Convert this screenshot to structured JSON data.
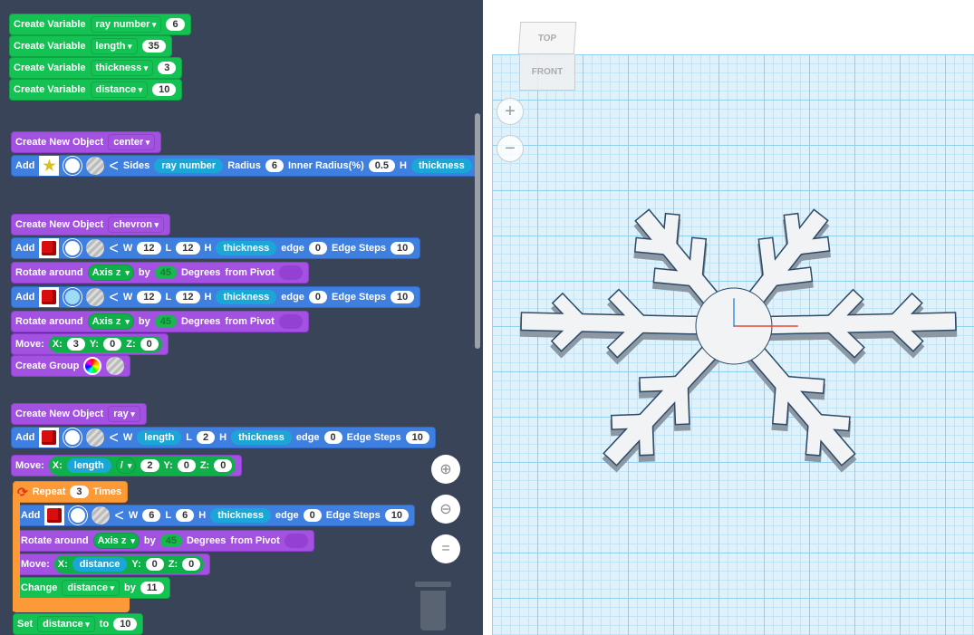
{
  "workspace": {
    "blocks": [
      {
        "color": "green",
        "parts": [
          [
            "l",
            "Create Variable"
          ],
          [
            "d",
            "ray number"
          ],
          [
            "p",
            "6"
          ]
        ]
      },
      {
        "color": "green",
        "parts": [
          [
            "l",
            "Create Variable"
          ],
          [
            "d",
            "length"
          ],
          [
            "p",
            "35"
          ]
        ]
      },
      {
        "color": "green",
        "parts": [
          [
            "l",
            "Create Variable"
          ],
          [
            "d",
            "thickness"
          ],
          [
            "p",
            "3"
          ]
        ]
      },
      {
        "color": "green",
        "parts": [
          [
            "l",
            "Create Variable"
          ],
          [
            "d",
            "distance"
          ],
          [
            "p",
            "10"
          ]
        ]
      },
      {
        "color": "purple",
        "parts": [
          [
            "l",
            "Create New Object"
          ],
          [
            "d",
            "center"
          ]
        ]
      },
      {
        "color": "blue",
        "parts": [
          [
            "l",
            "Add"
          ],
          [
            "i",
            "star"
          ],
          [
            "i",
            "circle"
          ],
          [
            "i",
            "striped"
          ],
          [
            "c",
            "<"
          ],
          [
            "l",
            "Sides"
          ],
          [
            "v",
            "ray number"
          ],
          [
            "l",
            "Radius"
          ],
          [
            "p",
            "6"
          ],
          [
            "l",
            "Inner Radius(%)"
          ],
          [
            "p",
            "0.5"
          ],
          [
            "l",
            "H"
          ],
          [
            "v",
            "thickness"
          ]
        ]
      },
      {
        "color": "purple",
        "parts": [
          [
            "l",
            "Create New Object"
          ],
          [
            "d",
            "chevron"
          ]
        ]
      },
      {
        "color": "blue",
        "parts": [
          [
            "l",
            "Add"
          ],
          [
            "i",
            "cube"
          ],
          [
            "i",
            "circle"
          ],
          [
            "i",
            "striped"
          ],
          [
            "c",
            "<"
          ],
          [
            "l",
            "W"
          ],
          [
            "p",
            "12"
          ],
          [
            "l",
            "L"
          ],
          [
            "p",
            "12"
          ],
          [
            "l",
            "H"
          ],
          [
            "v",
            "thickness"
          ],
          [
            "l",
            "edge"
          ],
          [
            "p",
            "0"
          ],
          [
            "l",
            "Edge Steps"
          ],
          [
            "p",
            "10"
          ]
        ]
      },
      {
        "color": "purple",
        "parts": [
          [
            "l",
            "Rotate around"
          ],
          [
            "gd",
            "Axis z"
          ],
          [
            "l",
            "by"
          ],
          [
            "g",
            "45"
          ],
          [
            "l",
            "Degrees"
          ],
          [
            "l",
            "from Pivot"
          ],
          [
            "i",
            "pivot"
          ]
        ]
      },
      {
        "color": "blue",
        "parts": [
          [
            "l",
            "Add"
          ],
          [
            "i",
            "cube"
          ],
          [
            "i",
            "circle-light"
          ],
          [
            "i",
            "striped"
          ],
          [
            "c",
            "<"
          ],
          [
            "l",
            "W"
          ],
          [
            "p",
            "12"
          ],
          [
            "l",
            "L"
          ],
          [
            "p",
            "12"
          ],
          [
            "l",
            "H"
          ],
          [
            "v",
            "thickness"
          ],
          [
            "l",
            "edge"
          ],
          [
            "p",
            "0"
          ],
          [
            "l",
            "Edge Steps"
          ],
          [
            "p",
            "10"
          ]
        ]
      },
      {
        "color": "purple",
        "parts": [
          [
            "l",
            "Rotate around"
          ],
          [
            "gd",
            "Axis z"
          ],
          [
            "l",
            "by"
          ],
          [
            "g",
            "45"
          ],
          [
            "l",
            "Degrees"
          ],
          [
            "l",
            "from Pivot"
          ],
          [
            "i",
            "pivot"
          ]
        ]
      },
      {
        "color": "purple",
        "parts": [
          [
            "l",
            "Move:"
          ],
          [
            "grp",
            [
              [
                "l",
                "X:"
              ],
              [
                "p",
                "3"
              ],
              [
                "l",
                "Y:"
              ],
              [
                "p",
                "0"
              ],
              [
                "l",
                "Z:"
              ],
              [
                "p",
                "0"
              ]
            ]
          ]
        ]
      },
      {
        "color": "purple",
        "parts": [
          [
            "l",
            "Create Group"
          ],
          [
            "i",
            "rainbow"
          ],
          [
            "i",
            "striped"
          ]
        ]
      },
      {
        "color": "purple",
        "parts": [
          [
            "l",
            "Create New Object"
          ],
          [
            "d",
            "ray"
          ]
        ]
      },
      {
        "color": "blue",
        "parts": [
          [
            "l",
            "Add"
          ],
          [
            "i",
            "cube"
          ],
          [
            "i",
            "circle"
          ],
          [
            "i",
            "striped"
          ],
          [
            "c",
            "<"
          ],
          [
            "l",
            "W"
          ],
          [
            "v",
            "length"
          ],
          [
            "l",
            "L"
          ],
          [
            "p",
            "2"
          ],
          [
            "l",
            "H"
          ],
          [
            "v",
            "thickness"
          ],
          [
            "l",
            "edge"
          ],
          [
            "p",
            "0"
          ],
          [
            "l",
            "Edge Steps"
          ],
          [
            "p",
            "10"
          ]
        ]
      },
      {
        "color": "purple",
        "parts": [
          [
            "l",
            "Move:"
          ],
          [
            "grp",
            [
              [
                "l",
                "X:"
              ],
              [
                "v",
                "length"
              ],
              [
                "gd",
                "/"
              ],
              [
                "p",
                "2"
              ],
              [
                "l",
                "Y:"
              ],
              [
                "p",
                "0"
              ],
              [
                "l",
                "Z:"
              ],
              [
                "p",
                "0"
              ]
            ]
          ]
        ]
      },
      {
        "color": "orange",
        "parts": [
          [
            "i",
            "repeat"
          ],
          [
            "l",
            "Repeat"
          ],
          [
            "p",
            "3"
          ],
          [
            "l",
            "Times"
          ]
        ]
      },
      {
        "color": "blue",
        "parts": [
          [
            "l",
            "Add"
          ],
          [
            "i",
            "cube"
          ],
          [
            "i",
            "circle"
          ],
          [
            "i",
            "striped"
          ],
          [
            "c",
            "<"
          ],
          [
            "l",
            "W"
          ],
          [
            "p",
            "6"
          ],
          [
            "l",
            "L"
          ],
          [
            "p",
            "6"
          ],
          [
            "l",
            "H"
          ],
          [
            "v",
            "thickness"
          ],
          [
            "l",
            "edge"
          ],
          [
            "p",
            "0"
          ],
          [
            "l",
            "Edge Steps"
          ],
          [
            "p",
            "10"
          ]
        ]
      },
      {
        "color": "purple",
        "parts": [
          [
            "l",
            "Rotate around"
          ],
          [
            "gd",
            "Axis z"
          ],
          [
            "l",
            "by"
          ],
          [
            "g",
            "45"
          ],
          [
            "l",
            "Degrees"
          ],
          [
            "l",
            "from Pivot"
          ],
          [
            "i",
            "pivot"
          ]
        ]
      },
      {
        "color": "purple",
        "parts": [
          [
            "l",
            "Move:"
          ],
          [
            "grp",
            [
              [
                "l",
                "X:"
              ],
              [
                "v",
                "distance"
              ],
              [
                "l",
                "Y:"
              ],
              [
                "p",
                "0"
              ],
              [
                "l",
                "Z:"
              ],
              [
                "p",
                "0"
              ]
            ]
          ]
        ]
      },
      {
        "color": "green",
        "parts": [
          [
            "l",
            "Change"
          ],
          [
            "d",
            "distance"
          ],
          [
            "l",
            "by"
          ],
          [
            "p",
            "11"
          ]
        ]
      },
      {
        "color": "green",
        "parts": [
          [
            "l",
            "Set"
          ],
          [
            "d",
            "distance"
          ],
          [
            "l",
            "to"
          ],
          [
            "p",
            "10"
          ]
        ]
      }
    ],
    "zoom_in": "⊕",
    "zoom_out": "⊖",
    "zoom_fit": "="
  },
  "viewport": {
    "viewcube_top": "TOP",
    "viewcube_front": "FRONT",
    "zoom_in": "+",
    "zoom_out": "−"
  },
  "colors": {
    "workspace": "#394458",
    "grid": "#8fd0ee",
    "x_axis": "#e8453c",
    "y_axis": "#3d8fe0"
  }
}
